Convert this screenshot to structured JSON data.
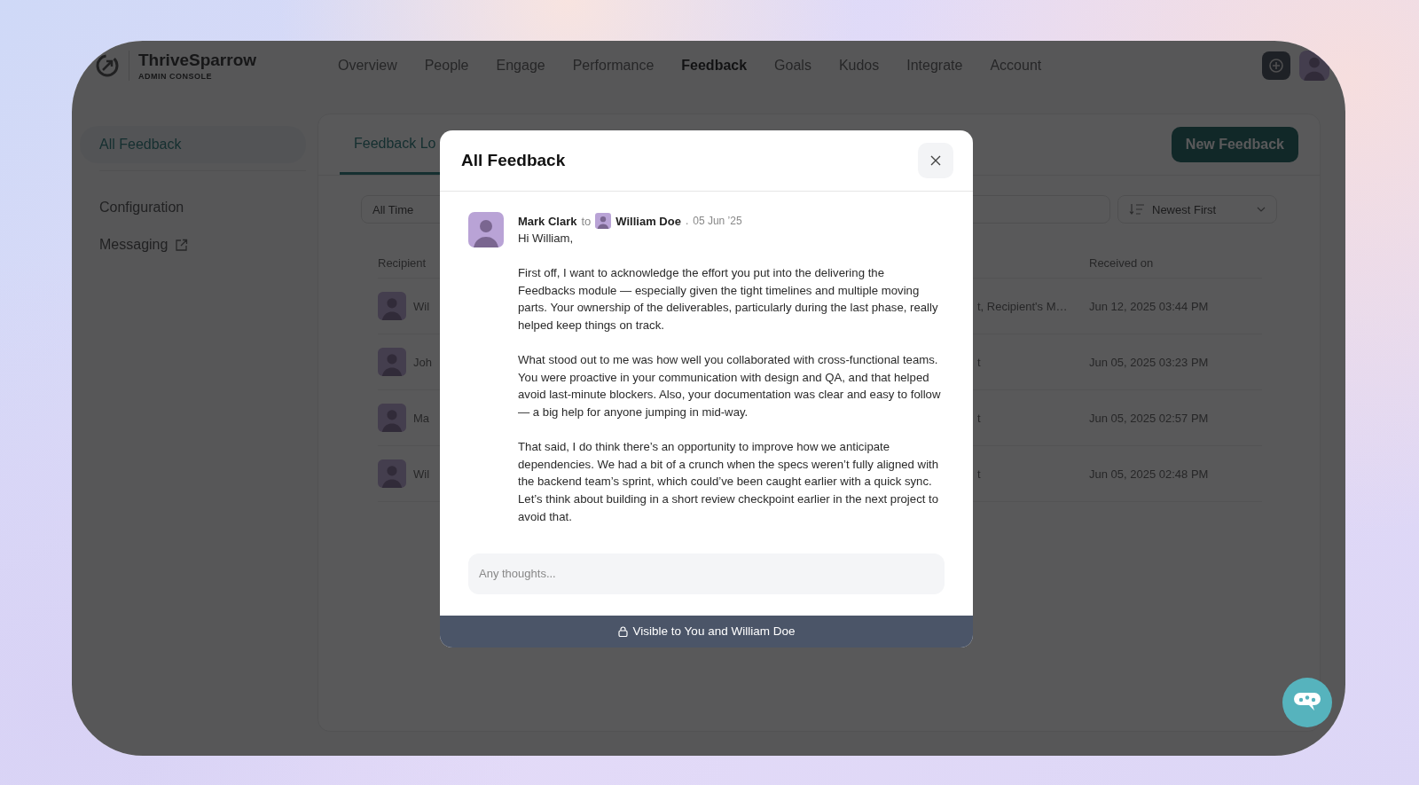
{
  "header": {
    "brand": "ThriveSparrow",
    "subtitle": "ADMIN CONSOLE",
    "nav": [
      {
        "label": "Overview",
        "selected": false
      },
      {
        "label": "People",
        "selected": false
      },
      {
        "label": "Engage",
        "selected": false
      },
      {
        "label": "Performance",
        "selected": false
      },
      {
        "label": "Feedback",
        "selected": true
      },
      {
        "label": "Goals",
        "selected": false
      },
      {
        "label": "Kudos",
        "selected": false
      },
      {
        "label": "Integrate",
        "selected": false
      },
      {
        "label": "Account",
        "selected": false
      }
    ]
  },
  "sidebar": {
    "items": [
      {
        "label": "All Feedback",
        "selected": true,
        "external": false
      },
      {
        "label": "Configuration",
        "selected": false,
        "external": false
      },
      {
        "label": "Messaging",
        "selected": false,
        "external": true
      }
    ]
  },
  "main": {
    "tabs": [
      {
        "label": "Feedback Lo",
        "selected": true
      }
    ],
    "new_button": "New Feedback",
    "filters": {
      "period": "All Time",
      "sort": "Newest First"
    },
    "table": {
      "columns": [
        "Recipient",
        "Received on"
      ],
      "rows": [
        {
          "recipient": "Wil",
          "column_3": "t, Recipient's M…",
          "received_on": "Jun 12, 2025 03:44 PM"
        },
        {
          "recipient": "Joh",
          "column_3": "t",
          "received_on": "Jun 05, 2025 03:23 PM"
        },
        {
          "recipient": "Ma",
          "column_3": "t",
          "received_on": "Jun 05, 2025 02:57 PM"
        },
        {
          "recipient": "Wil",
          "column_3": "t",
          "received_on": "Jun 05, 2025 02:48 PM"
        }
      ]
    }
  },
  "modal": {
    "title": "All Feedback",
    "author": "Mark Clark",
    "connector": "to",
    "recipient": "William Doe",
    "separator": ".",
    "date": "05 Jun ’25",
    "message": [
      "Hi William,",
      "First off, I want to acknowledge the effort you put into the delivering the Feedbacks module — especially given the tight timelines and multiple moving parts. Your ownership of the deliverables, particularly during the last phase, really helped keep things on track.",
      "What stood out to me was how well you collaborated with cross-functional teams. You were proactive in your communication with design and QA, and that helped avoid last-minute blockers. Also, your documentation was clear and easy to follow — a big help for anyone jumping in mid-way.",
      "That said, I do think there’s an opportunity to improve how we anticipate dependencies. We had a bit of a crunch when the specs weren’t fully aligned with the backend team’s sprint, which could’ve been caught earlier with a quick sync. Let’s think about building in a short review checkpoint earlier in the next project to avoid that."
    ],
    "reply_placeholder": "Any thoughts...",
    "visibility": "Visible to You and William Doe"
  }
}
